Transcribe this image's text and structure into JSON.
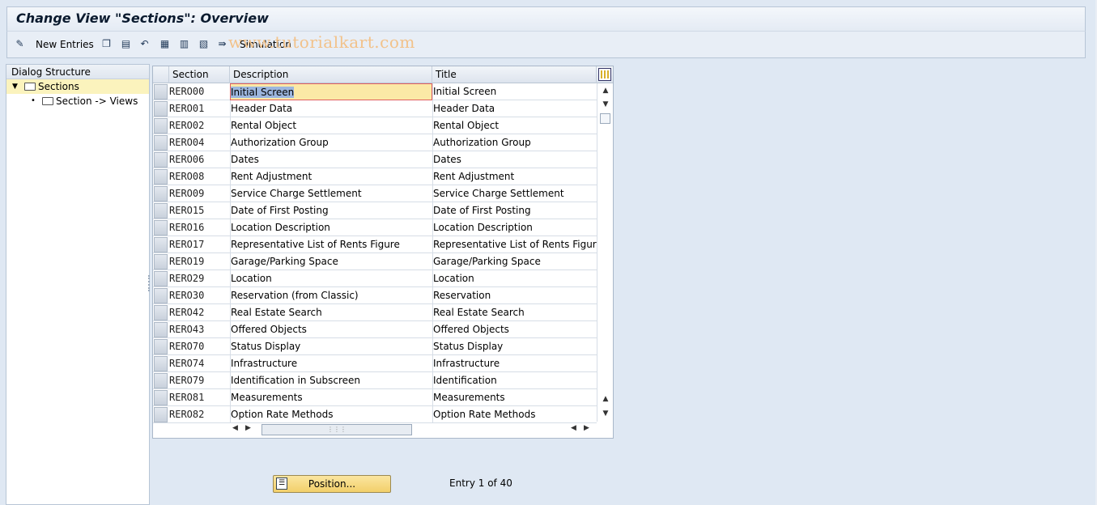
{
  "window": {
    "title": "Change View \"Sections\": Overview",
    "watermark": "www.tutorialkart.com"
  },
  "toolbar": {
    "new_entries_label": "New Entries",
    "simulation_label": "Simulation"
  },
  "dialog_structure": {
    "header": "Dialog Structure",
    "items": [
      {
        "label": "Sections",
        "expanded": true,
        "selected": true
      },
      {
        "label": "Section -> Views",
        "selected": false
      }
    ]
  },
  "table": {
    "columns": [
      "Section",
      "Description",
      "Title"
    ],
    "rows": [
      {
        "section": "RERO00",
        "description": "Initial Screen",
        "title": "Initial Screen"
      },
      {
        "section": "RERO01",
        "description": "Header Data",
        "title": "Header Data"
      },
      {
        "section": "RERO02",
        "description": "Rental Object",
        "title": "Rental Object"
      },
      {
        "section": "RERO04",
        "description": "Authorization Group",
        "title": "Authorization Group"
      },
      {
        "section": "RERO06",
        "description": "Dates",
        "title": "Dates"
      },
      {
        "section": "RERO08",
        "description": "Rent Adjustment",
        "title": "Rent Adjustment"
      },
      {
        "section": "RERO09",
        "description": "Service Charge Settlement",
        "title": "Service Charge Settlement"
      },
      {
        "section": "RERO15",
        "description": "Date of First Posting",
        "title": "Date of First Posting"
      },
      {
        "section": "RERO16",
        "description": "Location Description",
        "title": "Location Description"
      },
      {
        "section": "RERO17",
        "description": "Representative List of Rents Figure",
        "title": "Representative List of Rents Figure"
      },
      {
        "section": "RERO19",
        "description": "Garage/Parking Space",
        "title": "Garage/Parking Space"
      },
      {
        "section": "RERO29",
        "description": "Location",
        "title": "Location"
      },
      {
        "section": "RERO30",
        "description": "Reservation (from Classic)",
        "title": "Reservation"
      },
      {
        "section": "RERO42",
        "description": "Real Estate Search",
        "title": "Real Estate Search"
      },
      {
        "section": "RERO43",
        "description": "Offered Objects",
        "title": "Offered Objects"
      },
      {
        "section": "RERO70",
        "description": "Status Display",
        "title": "Status Display"
      },
      {
        "section": "RERO74",
        "description": "Infrastructure",
        "title": "Infrastructure"
      },
      {
        "section": "RERO79",
        "description": "Identification in Subscreen",
        "title": "Identification"
      },
      {
        "section": "RERO81",
        "description": "Measurements",
        "title": "Measurements"
      },
      {
        "section": "RERO82",
        "description": "Option Rate Methods",
        "title": "Option Rate Methods"
      }
    ]
  },
  "footer": {
    "position_button_label": "Position...",
    "entry_info": "Entry 1 of 40"
  },
  "colors": {
    "background": "#dfe8f3",
    "highlight_cell": "#fbe9a6",
    "position_button": "#f2cf6a"
  }
}
